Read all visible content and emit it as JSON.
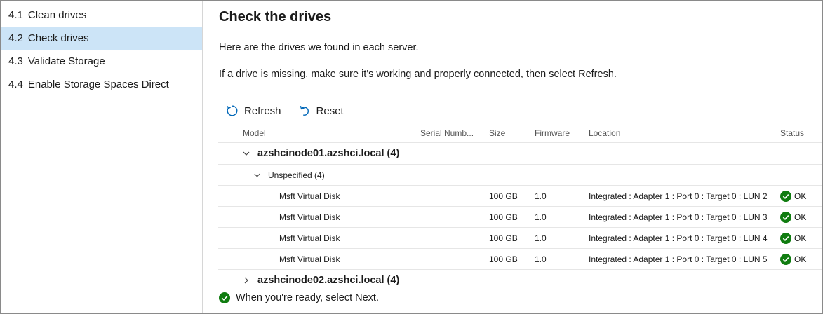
{
  "sidebar": {
    "items": [
      {
        "num": "4.1",
        "label": "Clean drives"
      },
      {
        "num": "4.2",
        "label": "Check drives"
      },
      {
        "num": "4.3",
        "label": "Validate Storage"
      },
      {
        "num": "4.4",
        "label": "Enable Storage Spaces Direct"
      }
    ],
    "selected_index": 1
  },
  "main": {
    "title": "Check the drives",
    "description1": "Here are the drives we found in each server.",
    "description2": "If a drive is missing, make sure it's working and properly connected, then select Refresh.",
    "toolbar": {
      "refresh_label": "Refresh",
      "reset_label": "Reset"
    },
    "grid": {
      "columns": {
        "model": "Model",
        "serial": "Serial Numb...",
        "size": "Size",
        "firmware": "Firmware",
        "location": "Location",
        "status": "Status"
      },
      "groups": [
        {
          "name": "azshcinode01.azshci.local (4)",
          "expanded": true,
          "subgroups": [
            {
              "name": "Unspecified (4)",
              "expanded": true,
              "rows": [
                {
                  "model": "Msft Virtual Disk",
                  "serial": "",
                  "size": "100 GB",
                  "firmware": "1.0",
                  "location": "Integrated : Adapter 1 : Port 0 : Target 0 : LUN 2",
                  "status": "OK"
                },
                {
                  "model": "Msft Virtual Disk",
                  "serial": "",
                  "size": "100 GB",
                  "firmware": "1.0",
                  "location": "Integrated : Adapter 1 : Port 0 : Target 0 : LUN 3",
                  "status": "OK"
                },
                {
                  "model": "Msft Virtual Disk",
                  "serial": "",
                  "size": "100 GB",
                  "firmware": "1.0",
                  "location": "Integrated : Adapter 1 : Port 0 : Target 0 : LUN 4",
                  "status": "OK"
                },
                {
                  "model": "Msft Virtual Disk",
                  "serial": "",
                  "size": "100 GB",
                  "firmware": "1.0",
                  "location": "Integrated : Adapter 1 : Port 0 : Target 0 : LUN 5",
                  "status": "OK"
                }
              ]
            }
          ]
        },
        {
          "name": "azshcinode02.azshci.local (4)",
          "expanded": false
        }
      ]
    },
    "footer_message": "When you're ready, select Next."
  },
  "colors": {
    "selected_bg": "#cce4f7",
    "accent_blue": "#0067b8",
    "ok_green": "#107c10"
  },
  "icons": {
    "refresh": "refresh-icon",
    "reset": "reset-icon",
    "status_ok": "check-circle-icon",
    "expand": "chevron-down-icon",
    "collapse": "chevron-right-icon"
  }
}
